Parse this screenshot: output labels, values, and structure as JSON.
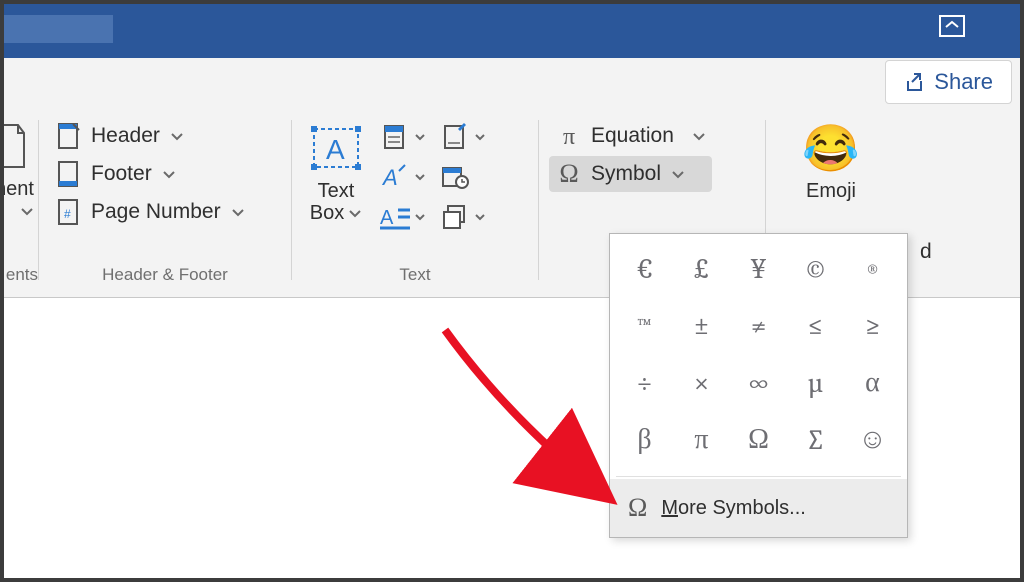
{
  "share": {
    "label": "Share"
  },
  "fragment": {
    "ment_label": "nent",
    "ents_group": "ents"
  },
  "hf": {
    "header": "Header",
    "footer": "Footer",
    "page_number": "Page Number",
    "group": "Header & Footer"
  },
  "text": {
    "textbox_line1": "Text",
    "textbox_line2": "Box",
    "group": "Text"
  },
  "symbols": {
    "equation": "Equation",
    "symbol": "Symbol",
    "emoji": "Emoji",
    "keyboard_last": "d",
    "more": "More Symbols...",
    "grid": [
      "€",
      "£",
      "¥",
      "©",
      "®",
      "™",
      "±",
      "≠",
      "≤",
      "≥",
      "÷",
      "×",
      "∞",
      "µ",
      "α",
      "β",
      "π",
      "Ω",
      "∑",
      "☺"
    ]
  }
}
